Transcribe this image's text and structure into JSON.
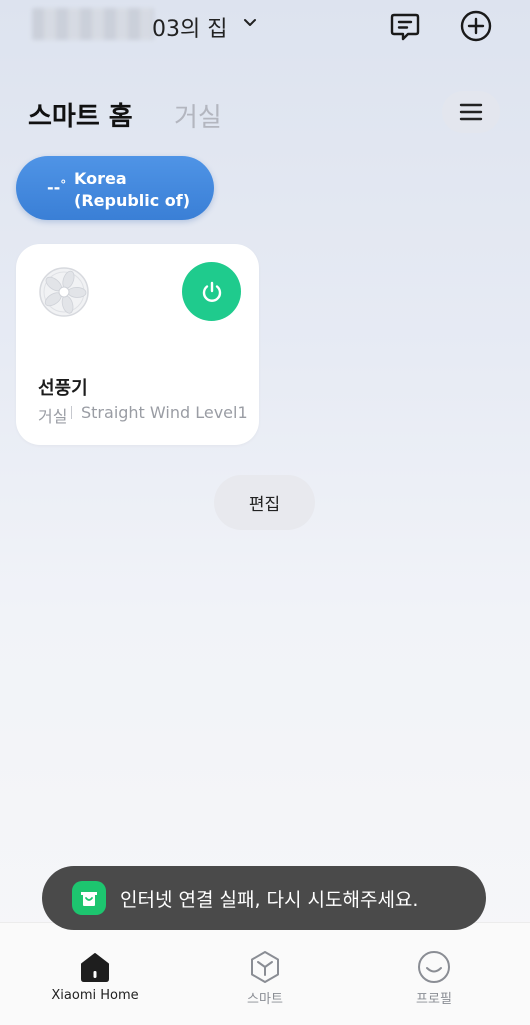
{
  "header": {
    "home_name": "03의 집",
    "chevron_icon": "chevron-down-icon",
    "message_icon": "message-icon",
    "add_icon": "add-icon"
  },
  "tabs": [
    {
      "label": "스마트 홈",
      "active": true
    },
    {
      "label": "거실",
      "active": false
    }
  ],
  "menu_icon": "menu-icon",
  "weather": {
    "dashes": "--",
    "degree": "°",
    "location_line1": "Korea",
    "location_line2": "(Republic of)"
  },
  "device": {
    "name": "선풍기",
    "room": "거실",
    "status": "Straight Wind Level1",
    "icon": "fan-icon",
    "power_icon": "power-icon",
    "power_color": "#1fcb8d"
  },
  "edit_label": "편집",
  "toast": {
    "icon": "mi-home-logo",
    "message": "인터넷 연결 실패, 다시 시도해주세요."
  },
  "nav": [
    {
      "label": "Xiaomi Home",
      "icon": "home-icon",
      "active": true
    },
    {
      "label": "스마트",
      "icon": "cube-icon",
      "active": false
    },
    {
      "label": "프로필",
      "icon": "smile-icon",
      "active": false
    }
  ],
  "colors": {
    "accent_green": "#1fcb8d",
    "weather_blue": "#3a7fd6"
  }
}
